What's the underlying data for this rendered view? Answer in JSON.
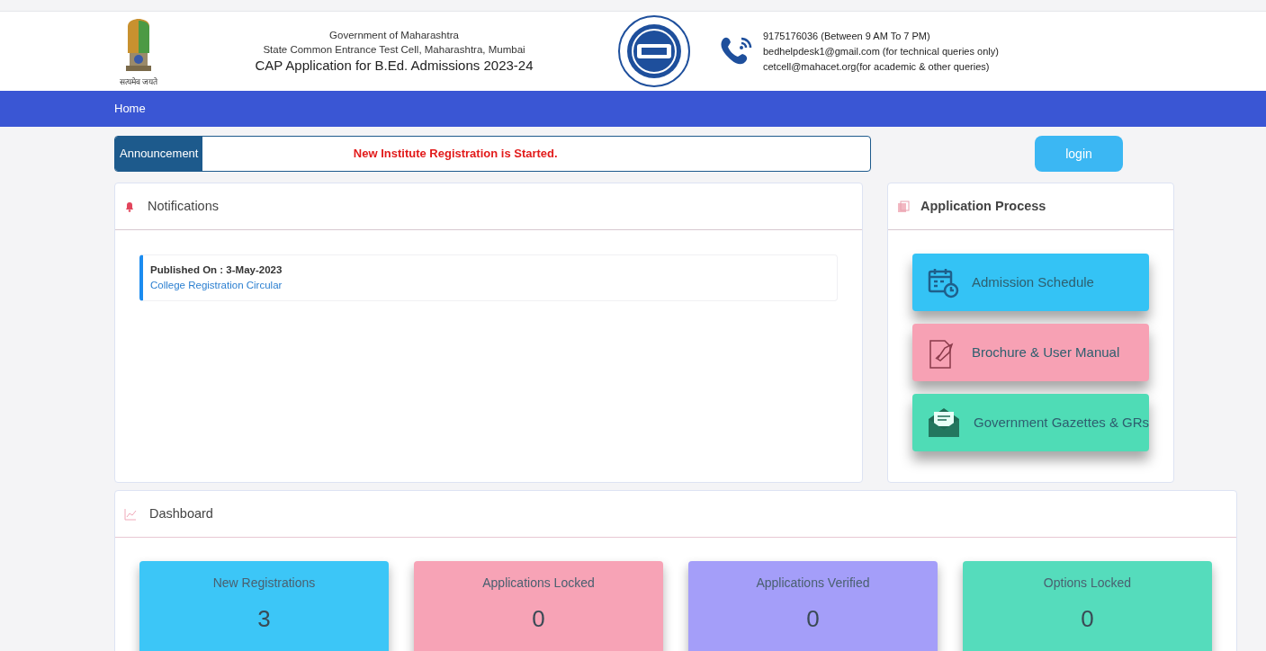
{
  "header": {
    "lines": [
      "Government of Maharashtra",
      "State Common Entrance Test Cell, Maharashtra, Mumbai",
      "CAP Application for B.Ed. Admissions 2023-24"
    ],
    "emblem_caption": "सत्यमेव जयते",
    "contact": [
      "9175176036 (Between 9 AM To 7 PM)",
      "bedhelpdesk1@gmail.com (for technical queries only)",
      "cetcell@mahacet.org(for academic & other queries)"
    ]
  },
  "nav": {
    "items": [
      {
        "label": "Home",
        "selected": true
      }
    ]
  },
  "announcement": {
    "label": "Announcement",
    "text": "New Institute Registration is Started."
  },
  "login": {
    "label": "login"
  },
  "notifications": {
    "title": "Notifications",
    "items": [
      {
        "published": "Published On : 3-May-2023",
        "link": "College Registration Circular"
      }
    ]
  },
  "application_process": {
    "title": "Application Process",
    "items": [
      {
        "kind": "calendar",
        "label": "Admission Schedule",
        "color": "#34c3f5"
      },
      {
        "kind": "document",
        "label": "Brochure & User Manual",
        "color": "#f7a1b4"
      },
      {
        "kind": "envelope",
        "label": "Government Gazettes & GRs",
        "color": "#4fdcb6"
      }
    ]
  },
  "dashboard": {
    "title": "Dashboard",
    "cards": [
      {
        "label": "New Registrations",
        "value": "3",
        "color": "#3cc6f7"
      },
      {
        "label": "Applications Locked",
        "value": "0",
        "color": "#f7a3b6"
      },
      {
        "label": "Applications Verified",
        "value": "0",
        "color": "#a49ef9"
      },
      {
        "label": "Options Locked",
        "value": "0",
        "color": "#55dcbc"
      }
    ]
  }
}
